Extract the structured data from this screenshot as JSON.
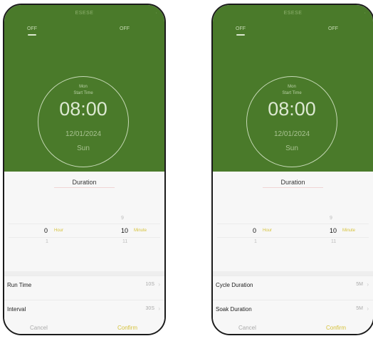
{
  "screens": [
    {
      "id": "left",
      "status_title": "ESESE",
      "tabs": [
        "OFF",
        "OFF"
      ],
      "clock": {
        "caption_line1": "Mon",
        "caption_line2": "Start Time",
        "time": "08:00",
        "date": "12/01/2024",
        "day": "Sun"
      },
      "sheet": {
        "title": "Duration",
        "hour_value": "0",
        "hour_unit": "Hour",
        "hour_below": "1",
        "minute_above": "9",
        "minute_value": "10",
        "minute_unit": "Minute",
        "minute_below": "11"
      },
      "rows": [
        {
          "label": "Run Time",
          "value": "10S"
        },
        {
          "label": "Interval",
          "value": "30S"
        }
      ],
      "buttons": {
        "cancel": "Cancel",
        "confirm": "Confirm"
      }
    },
    {
      "id": "right",
      "status_title": "ESESE",
      "tabs": [
        "OFF",
        "OFF"
      ],
      "clock": {
        "caption_line1": "Mon",
        "caption_line2": "Start Time",
        "time": "08:00",
        "date": "12/01/2024",
        "day": "Sun"
      },
      "sheet": {
        "title": "Duration",
        "hour_value": "0",
        "hour_unit": "Hour",
        "hour_below": "1",
        "minute_above": "9",
        "minute_value": "10",
        "minute_unit": "Minute",
        "minute_below": "11"
      },
      "rows": [
        {
          "label": "Cycle Duration",
          "value": "5M"
        },
        {
          "label": "Soak Duration",
          "value": "5M"
        }
      ],
      "buttons": {
        "cancel": "Cancel",
        "confirm": "Confirm"
      }
    }
  ],
  "colors": {
    "header_green": "#4a7a2a",
    "accent_yellow": "#d6c23a",
    "ring": "#c6d9b6"
  },
  "icons": {
    "row_chevron": "chevron-right-icon"
  }
}
